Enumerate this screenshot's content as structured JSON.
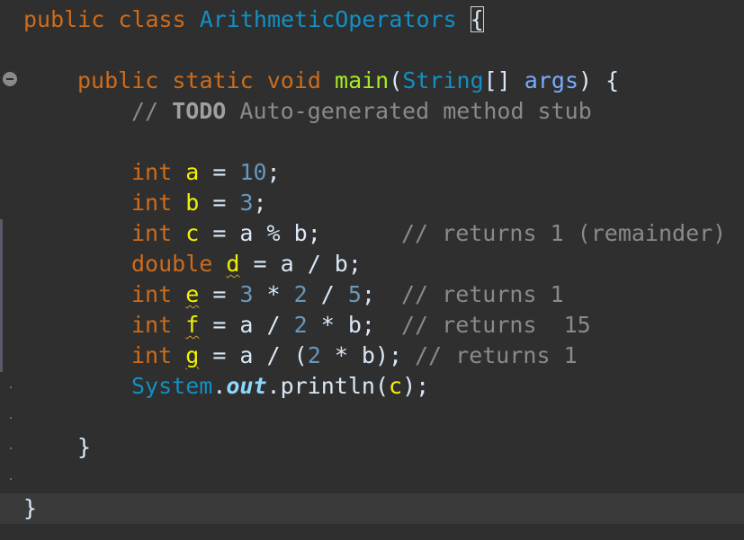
{
  "editor": {
    "lines": {
      "class_decl": {
        "kw_public": "public",
        "kw_class": "class",
        "class_name": "ArithmeticOperators",
        "space": " ",
        "open_brace": "{"
      },
      "main_decl": {
        "kw_public": "public",
        "kw_static": "static",
        "kw_void": "void",
        "method_name": "main",
        "open_paren": "(",
        "param_type": "String",
        "array_brackets": "[]",
        "param_name": "args",
        "close_paren_brace": ") {"
      },
      "todo_comment": {
        "prefix": "// ",
        "todo": "TODO",
        "text": " Auto-generated method stub"
      },
      "decl_a": {
        "type": "int",
        "var": "a",
        "op": " = ",
        "value": "10",
        "end": ";"
      },
      "decl_b": {
        "type": "int",
        "var": "b",
        "op": " = ",
        "value": "3",
        "end": ";"
      },
      "decl_c": {
        "type": "int",
        "var": "c",
        "expr": " = a % b;",
        "comment": "// returns 1 (remainder)"
      },
      "decl_d": {
        "type": "double",
        "var": "d",
        "expr": " = a / b;"
      },
      "decl_e": {
        "type": "int",
        "var": "e",
        "eq": " = ",
        "n1": "3",
        "op1": " * ",
        "n2": "2",
        "op2": " / ",
        "n3": "5",
        "end": ";",
        "comment": "// returns 1"
      },
      "decl_f": {
        "type": "int",
        "var": "f",
        "eq": " = a / ",
        "n1": "2",
        "rest": " * b;",
        "comment": "// returns  15"
      },
      "decl_g": {
        "type": "int",
        "var": "g",
        "eq": " = a / (",
        "n1": "2",
        "rest": " * b);",
        "comment": "// returns 1"
      },
      "println": {
        "class": "System",
        "dot1": ".",
        "field": "out",
        "call": ".println(",
        "arg": "c",
        "end": ");"
      },
      "close_method": "}",
      "close_class": "}"
    }
  },
  "colors": {
    "background": "#2f2f2f",
    "keyword": "#cc6c1d",
    "type": "#1290c3",
    "method": "#a7ec21",
    "parameter": "#79abff",
    "number": "#6897bb",
    "local_variable": "#f2f200",
    "comment": "#8a8a8a",
    "text": "#d9e8f7",
    "current_line": "#3a3a3a"
  },
  "icons": {
    "fold": "collapse-fold-icon"
  }
}
